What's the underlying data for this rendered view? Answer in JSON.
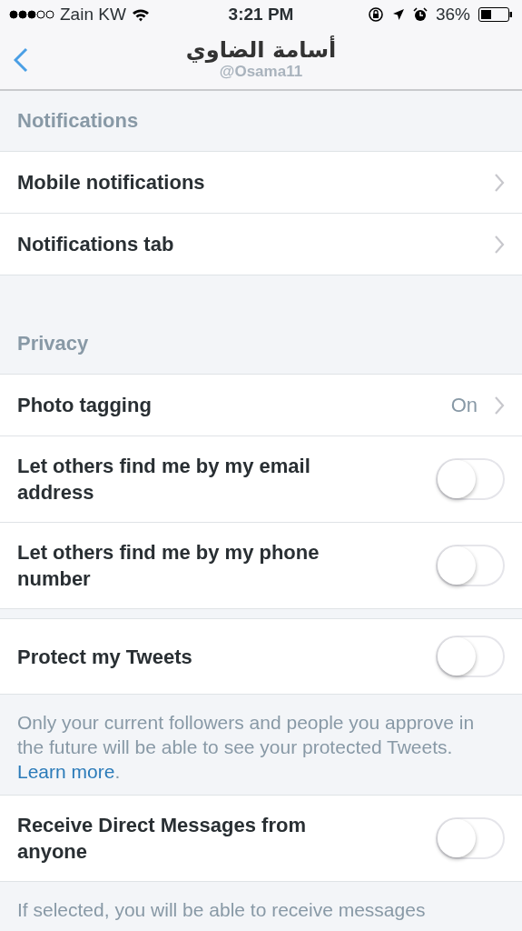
{
  "status_bar": {
    "carrier": "Zain KW",
    "time": "3:21 PM",
    "battery": "36%"
  },
  "nav": {
    "title": "أسامة الضاوي",
    "subtitle": "@Osama11"
  },
  "items": [
    {
      "kind": "header",
      "label": "Notifications"
    },
    {
      "kind": "link",
      "label": "Mobile notifications"
    },
    {
      "kind": "link",
      "label": "Notifications tab"
    },
    {
      "kind": "spacer"
    },
    {
      "kind": "header",
      "label": "Privacy"
    },
    {
      "kind": "link",
      "label": "Photo tagging",
      "value": "On"
    },
    {
      "kind": "toggle",
      "label": "Let others find me by my email address",
      "on": false
    },
    {
      "kind": "toggle",
      "label": "Let others find me by my phone number",
      "on": false
    },
    {
      "kind": "gap"
    },
    {
      "kind": "toggle",
      "label": "Protect my Tweets",
      "on": false
    },
    {
      "kind": "note",
      "text": "Only your current followers and people you approve in the future will be able to see your protected Tweets. ",
      "link": "Learn more",
      "after": "."
    },
    {
      "kind": "toggle",
      "label": "Receive Direct Messages from anyone",
      "on": false
    },
    {
      "kind": "note",
      "text": "If selected, you will be able to receive messages"
    }
  ]
}
